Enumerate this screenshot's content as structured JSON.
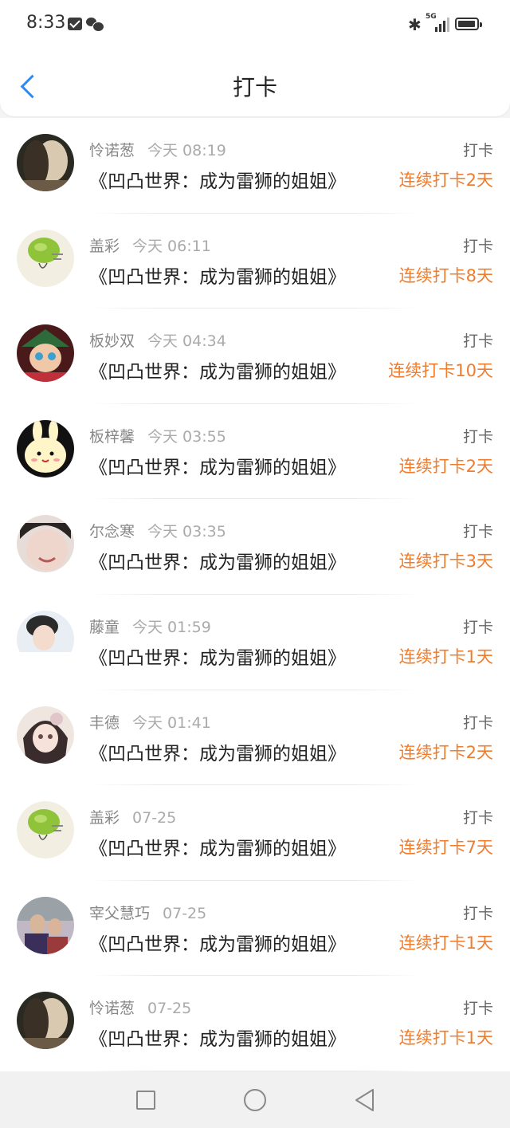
{
  "status": {
    "time": "8:33",
    "network": "5G"
  },
  "header": {
    "title": "打卡"
  },
  "colors": {
    "accent": "#2d8cf0",
    "streak": "#f07c2e"
  },
  "entries": [
    {
      "user": "怜诺葱",
      "time": "今天 08:19",
      "book": "《凹凸世界：成为雷狮的姐姐》",
      "action": "打卡",
      "streak": "连续打卡2天",
      "avatar": "dark-portrait"
    },
    {
      "user": "盖彩",
      "time": "今天 06:11",
      "book": "《凹凸世界：成为雷狮的姐姐》",
      "action": "打卡",
      "streak": "连续打卡8天",
      "avatar": "lime-sketch"
    },
    {
      "user": "板妙双",
      "time": "今天 04:34",
      "book": "《凹凸世界：成为雷狮的姐姐》",
      "action": "打卡",
      "streak": "连续打卡10天",
      "avatar": "anime-hat"
    },
    {
      "user": "板梓馨",
      "time": "今天 03:55",
      "book": "《凹凸世界：成为雷狮的姐姐》",
      "action": "打卡",
      "streak": "连续打卡2天",
      "avatar": "bunny-cartoon"
    },
    {
      "user": "尔念寒",
      "time": "今天 03:35",
      "book": "《凹凸世界：成为雷狮的姐姐》",
      "action": "打卡",
      "streak": "连续打卡3天",
      "avatar": "smiling-face"
    },
    {
      "user": "藤童",
      "time": "今天 01:59",
      "book": "《凹凸世界：成为雷狮的姐姐》",
      "action": "打卡",
      "streak": "连续打卡1天",
      "avatar": "boy-portrait"
    },
    {
      "user": "丰德",
      "time": "今天 01:41",
      "book": "《凹凸世界：成为雷狮的姐姐》",
      "action": "打卡",
      "streak": "连续打卡2天",
      "avatar": "anime-girl"
    },
    {
      "user": "盖彩",
      "time": "07-25",
      "book": "《凹凸世界：成为雷狮的姐姐》",
      "action": "打卡",
      "streak": "连续打卡7天",
      "avatar": "lime-sketch"
    },
    {
      "user": "宰父慧巧",
      "time": "07-25",
      "book": "《凹凸世界：成为雷狮的姐姐》",
      "action": "打卡",
      "streak": "连续打卡1天",
      "avatar": "group-photo"
    },
    {
      "user": "怜诺葱",
      "time": "07-25",
      "book": "《凹凸世界：成为雷狮的姐姐》",
      "action": "打卡",
      "streak": "连续打卡1天",
      "avatar": "dark-portrait"
    }
  ],
  "nav": {
    "recents": "recents-icon",
    "home": "home-icon",
    "back": "back-icon"
  }
}
